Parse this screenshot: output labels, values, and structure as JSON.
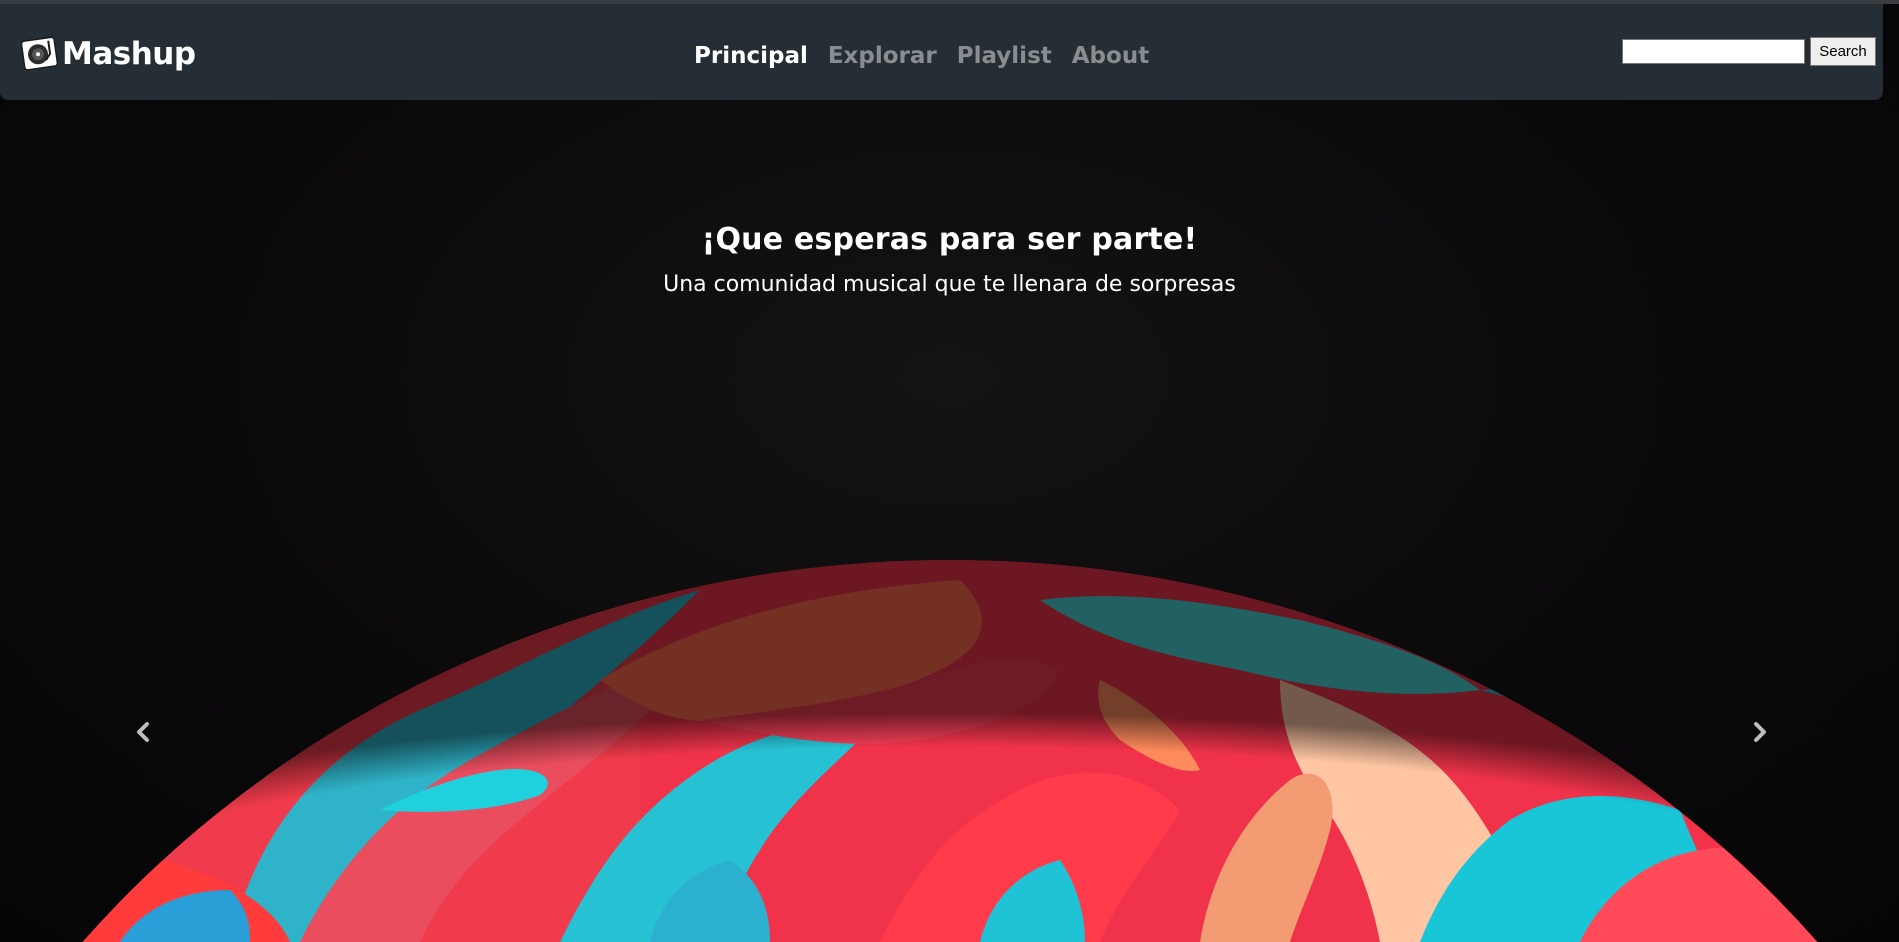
{
  "navbar": {
    "brand_name": "Mashup",
    "brand_icon": "turntable-icon",
    "links": [
      {
        "label": "Principal",
        "active": true
      },
      {
        "label": "Explorar",
        "active": false
      },
      {
        "label": "Playlist",
        "active": false
      },
      {
        "label": "About",
        "active": false
      }
    ],
    "search": {
      "value": "",
      "placeholder": "",
      "button_label": "Search"
    },
    "background_color": "#252e34",
    "active_link_color": "#ffffff",
    "inactive_link_color": "#8a8d8f"
  },
  "hero": {
    "title": "¡Que esperas para ser parte!",
    "subtitle": "Una comunidad musical que te llenara de sorpresas",
    "prev_icon": "chevron-left-icon",
    "next_icon": "chevron-right-icon",
    "image_subject": "colorful-soap-bubble"
  }
}
